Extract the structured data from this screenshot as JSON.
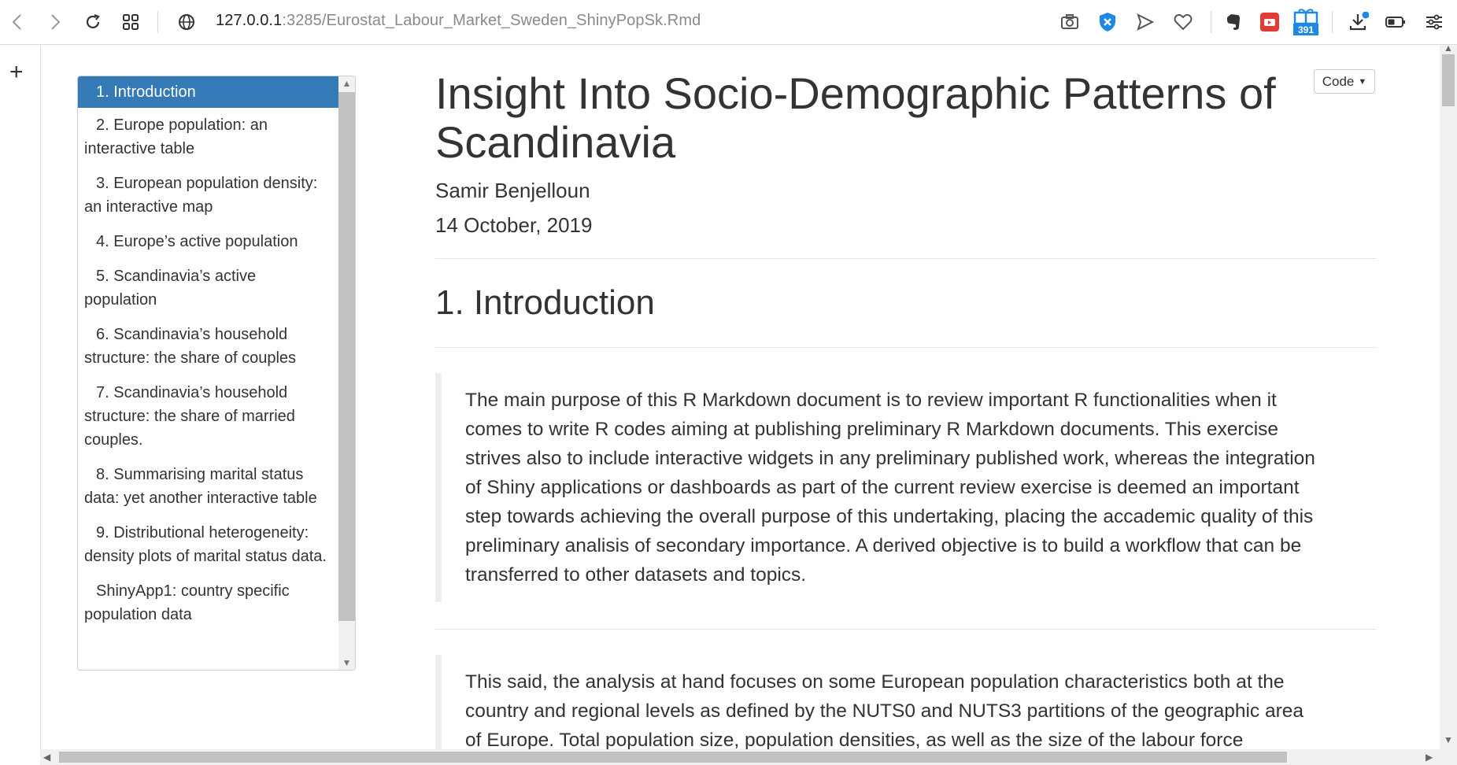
{
  "browser": {
    "url_host": "127.0.0.1",
    "url_rest": ":3285/Eurostat_Labour_Market_Sweden_ShinyPopSk.Rmd",
    "extension_badge": "391",
    "icons": [
      "back-icon",
      "forward-icon",
      "reload-icon",
      "apps-grid-icon",
      "globe-icon",
      "camera-icon",
      "shield-icon",
      "send-icon",
      "heart-icon",
      "evernote-icon",
      "youtube-icon",
      "gift-icon",
      "download-icon",
      "battery-icon",
      "menu-icon"
    ]
  },
  "sidebar": {
    "add_label": "+"
  },
  "toc": {
    "items": [
      {
        "label": "1. Introduction",
        "active": true
      },
      {
        "label": "2. Europe population: an interactive table"
      },
      {
        "label": "3. European population density: an interactive map"
      },
      {
        "label": "4. Europe’s active population"
      },
      {
        "label": "5. Scandinavia’s active population"
      },
      {
        "label": "6. Scandinavia’s household structure: the share of couples"
      },
      {
        "label": "7. Scandinavia’s household structure: the share of married couples."
      },
      {
        "label": "8. Summarising marital status data: yet another interactive table"
      },
      {
        "label": "9. Distributional heterogeneity: density plots of marital status data."
      },
      {
        "label": "ShinyApp1: country specific population data"
      }
    ]
  },
  "document": {
    "code_button": "Code",
    "title": "Insight Into Socio-Demographic Patterns of Scandinavia",
    "author": "Samir Benjelloun",
    "date": "14 October, 2019",
    "section1_heading": "1. Introduction",
    "paragraph1": "The main purpose of this R Markdown document is to review important R functionalities when it comes to write R codes aiming at publishing preliminary R Markdown documents. This exercise strives also to include interactive widgets in any preliminary published work, whereas the integration of Shiny applications or dashboards as part of the current review exercise is deemed an important step towards achieving the overall purpose of this undertaking, placing the accademic quality of this preliminary analisis of secondary importance. A derived objective is to build a workflow that can be transferred to other datasets and topics.",
    "paragraph2": "This said, the analysis at hand focuses on some European population characteristics both at the country and regional levels as defined by the NUTS0 and NUTS3 partitions of the geographic area of Europe. Total population size, population densities, as well as the size of the labour force"
  }
}
